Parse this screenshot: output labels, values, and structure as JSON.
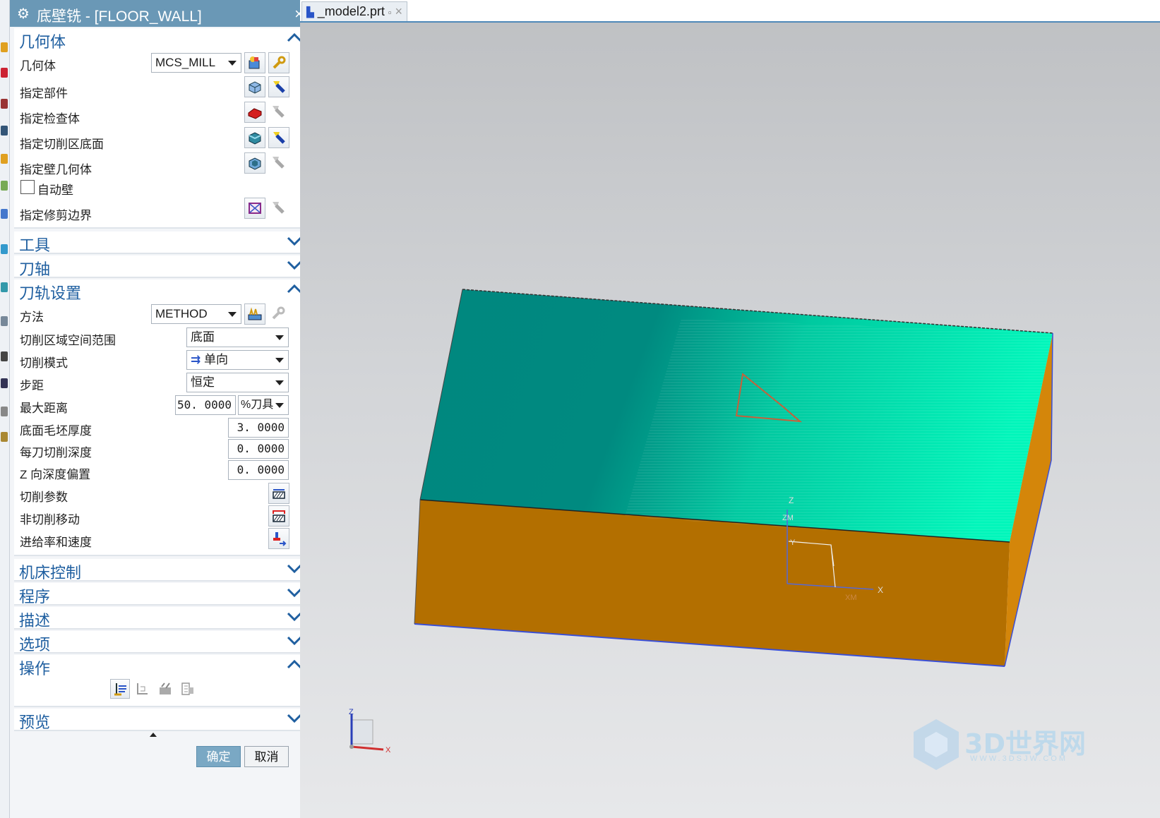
{
  "dialog": {
    "title": "底壁铣 - [FLOOR_WALL]",
    "close_glyph": "×",
    "settings_glyph": "⚙"
  },
  "geometry_section": {
    "title": "几何体",
    "geometry_label": "几何体",
    "geometry_value": "MCS_MILL",
    "specify_part": "指定部件",
    "specify_check": "指定检查体",
    "specify_floor": "指定切削区底面",
    "specify_wall": "指定壁几何体",
    "auto_wall": "自动壁",
    "auto_wall_checked": false,
    "specify_trim": "指定修剪边界"
  },
  "tool_section": {
    "title": "工具"
  },
  "axis_section": {
    "title": "刀轴"
  },
  "path_section": {
    "title": "刀轨设置",
    "method_label": "方法",
    "method_value": "METHOD",
    "cut_area_label": "切削区域空间范围",
    "cut_area_value": "底面",
    "cut_pattern_label": "切削模式",
    "cut_pattern_value": "单向",
    "stepover_label": "步距",
    "stepover_value": "恒定",
    "max_dist_label": "最大距离",
    "max_dist_value": "50. 0000",
    "max_dist_unit": "%刀具",
    "floor_stock_label": "底面毛坯厚度",
    "floor_stock_value": "3. 0000",
    "depth_per_cut_label": "每刀切削深度",
    "depth_per_cut_value": "0. 0000",
    "z_offset_label": "Z 向深度偏置",
    "z_offset_value": "0. 0000",
    "cut_params_label": "切削参数",
    "non_cut_label": "非切削移动",
    "feeds_label": "进给率和速度"
  },
  "machine_section": {
    "title": "机床控制"
  },
  "program_section": {
    "title": "程序"
  },
  "desc_section": {
    "title": "描述"
  },
  "options_section": {
    "title": "选项"
  },
  "actions_section": {
    "title": "操作"
  },
  "preview_section": {
    "title": "预览"
  },
  "buttons": {
    "ok": "确定",
    "cancel": "取消"
  },
  "tab": {
    "label": "_model2.prt",
    "close": "×"
  },
  "viewport": {
    "axis_labels": {
      "x": "X",
      "y": "Y",
      "z": "Z",
      "xm": "XM",
      "zm": "ZM"
    },
    "colors": {
      "top_dark": "#00877f",
      "top_light": "#00f5b8",
      "side": "#b36f00",
      "edge": "#3a4fd6"
    }
  },
  "watermark": {
    "text": "3D世界网",
    "url": "WWW.3DSJW.COM"
  }
}
